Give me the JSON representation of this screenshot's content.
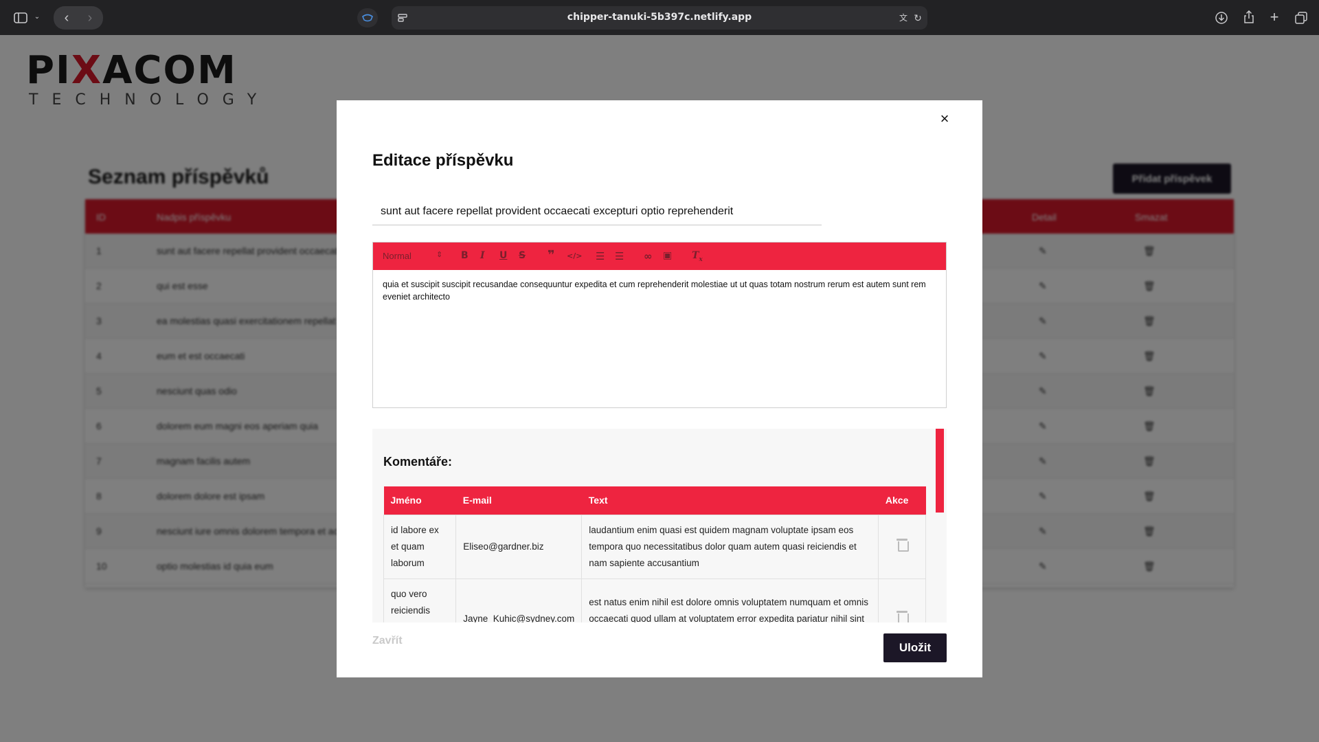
{
  "browser": {
    "url": "chipper-tanuki-5b397c.netlify.app"
  },
  "background": {
    "logo_main_a": "PI",
    "logo_main_x": "X",
    "logo_main_b": "ACOM",
    "logo_sub": "TECHNOLOGY",
    "page_title": "Seznam příspěvků",
    "add_button": "Přidat příspěvek",
    "columns": {
      "id": "ID",
      "name": "Nadpis příspěvku",
      "detail": "Detail",
      "delete": "Smazat"
    },
    "rows": [
      {
        "id": "1",
        "title": "sunt aut facere repellat provident occaecati excepturi optio reprehenderit"
      },
      {
        "id": "2",
        "title": "qui est esse"
      },
      {
        "id": "3",
        "title": "ea molestias quasi exercitationem repellat qui ipsa sit aut"
      },
      {
        "id": "4",
        "title": "eum et est occaecati"
      },
      {
        "id": "5",
        "title": "nesciunt quas odio"
      },
      {
        "id": "6",
        "title": "dolorem eum magni eos aperiam quia"
      },
      {
        "id": "7",
        "title": "magnam facilis autem"
      },
      {
        "id": "8",
        "title": "dolorem dolore est ipsam"
      },
      {
        "id": "9",
        "title": "nesciunt iure omnis dolorem tempora et accusantium"
      },
      {
        "id": "10",
        "title": "optio molestias id quia eum"
      }
    ]
  },
  "modal": {
    "close_symbol": "×",
    "title": "Editace příspěvku",
    "post_title_value": "sunt aut facere repellat provident occaecati excepturi optio reprehenderit",
    "editor": {
      "format_select": "Normal",
      "body": "quia et suscipit suscipit recusandae consequuntur expedita et cum reprehenderit molestiae ut ut quas totam nostrum rerum est autem sunt rem eveniet architecto"
    },
    "comments": {
      "heading": "Komentáře:",
      "columns": {
        "name": "Jméno",
        "email": "E-mail",
        "text": "Text",
        "actions": "Akce"
      },
      "rows": [
        {
          "name": "id labore ex et quam laborum",
          "email": "Eliseo@gardner.biz",
          "text": "laudantium enim quasi est quidem magnam voluptate ipsam eos tempora quo necessitatibus dolor quam autem quasi reiciendis et nam sapiente accusantium"
        },
        {
          "name": "quo vero reiciendis velit similique earum",
          "email": "Jayne_Kuhic@sydney.com",
          "text": "est natus enim nihil est dolore omnis voluptatem numquam et omnis occaecati quod ullam at voluptatem error expedita pariatur nihil sint nostrum voluptatem reiciendis et"
        }
      ]
    },
    "close_label": "Zavřít",
    "save_label": "Uložit"
  },
  "colors": {
    "accent": "#ee2440",
    "dark_button": "#1c1727"
  }
}
